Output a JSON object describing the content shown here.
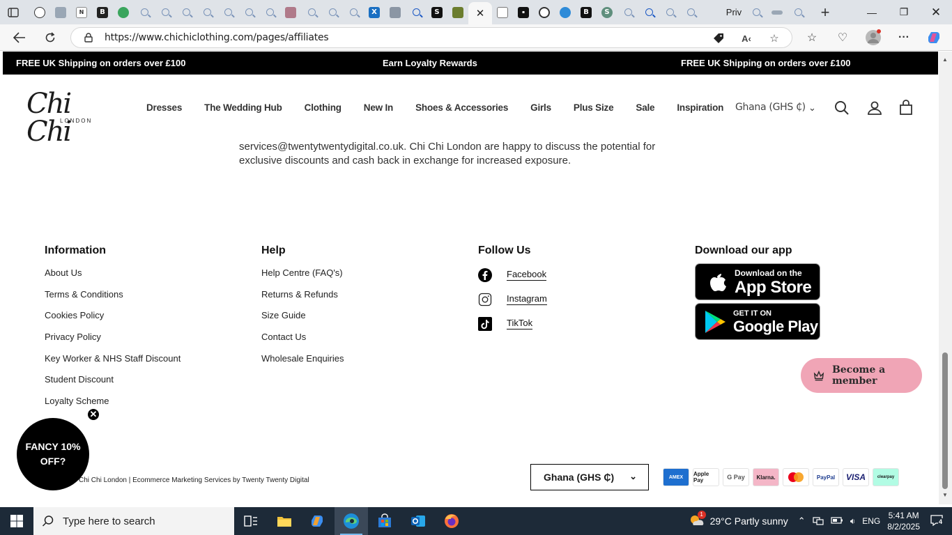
{
  "browser": {
    "active_tab_label": "Priv",
    "url": "https://www.chichiclothing.com/pages/affiliates"
  },
  "promo": {
    "left": "FREE UK Shipping on orders over £100",
    "center": "Earn Loyalty Rewards",
    "right": "FREE UK Shipping on orders over £100"
  },
  "header": {
    "logo_main": "Chi Chi",
    "logo_sub": "LONDON",
    "nav": [
      "Dresses",
      "The Wedding Hub",
      "Clothing",
      "New In",
      "Shoes & Accessories",
      "Girls",
      "Plus Size",
      "Sale",
      "Inspiration"
    ],
    "region": "Ghana (GHS ₵)"
  },
  "body_text": "services@twentytwentydigital.co.uk. Chi Chi London are happy to discuss the potential for exclusive discounts and cash back in exchange for increased exposure.",
  "footer": {
    "information": {
      "title": "Information",
      "links": [
        "About Us",
        "Terms & Conditions",
        "Cookies Policy",
        "Privacy Policy",
        "Key Worker & NHS Staff Discount",
        "Student Discount",
        "Loyalty Scheme"
      ]
    },
    "help": {
      "title": "Help",
      "links": [
        "Help Centre (FAQ's)",
        "Returns & Refunds",
        "Size Guide",
        "Contact Us",
        "Wholesale Enquiries"
      ]
    },
    "follow": {
      "title": "Follow Us",
      "links": [
        "Facebook",
        "Instagram",
        "TikTok"
      ]
    },
    "app": {
      "title": "Download our app",
      "appstore_small": "Download on the",
      "appstore_big": "App Store",
      "play_small": "GET IT ON",
      "play_big": "Google Play"
    },
    "copyright": "Chi Chi London | Ecommerce Marketing Services by Twenty Twenty Digital",
    "country_select": "Ghana (GHS ₵)",
    "payments": [
      "AMEX",
      "Apple Pay",
      "G Pay",
      "Klarna.",
      "Mastercard",
      "PayPal",
      "VISA",
      "clearpay"
    ]
  },
  "member_button": "Become a member",
  "fancy_popup": "FANCY 10% OFF?",
  "taskbar": {
    "search_placeholder": "Type here to search",
    "weather": "29°C Partly sunny",
    "lang": "ENG",
    "time": "5:41 AM",
    "date": "8/2/2025",
    "notifications": "4",
    "weather_badge": "1"
  },
  "colors": {
    "promo_bg": "#000000",
    "member_pink": "#f0a5b6",
    "taskbar": "#1d2a38"
  }
}
